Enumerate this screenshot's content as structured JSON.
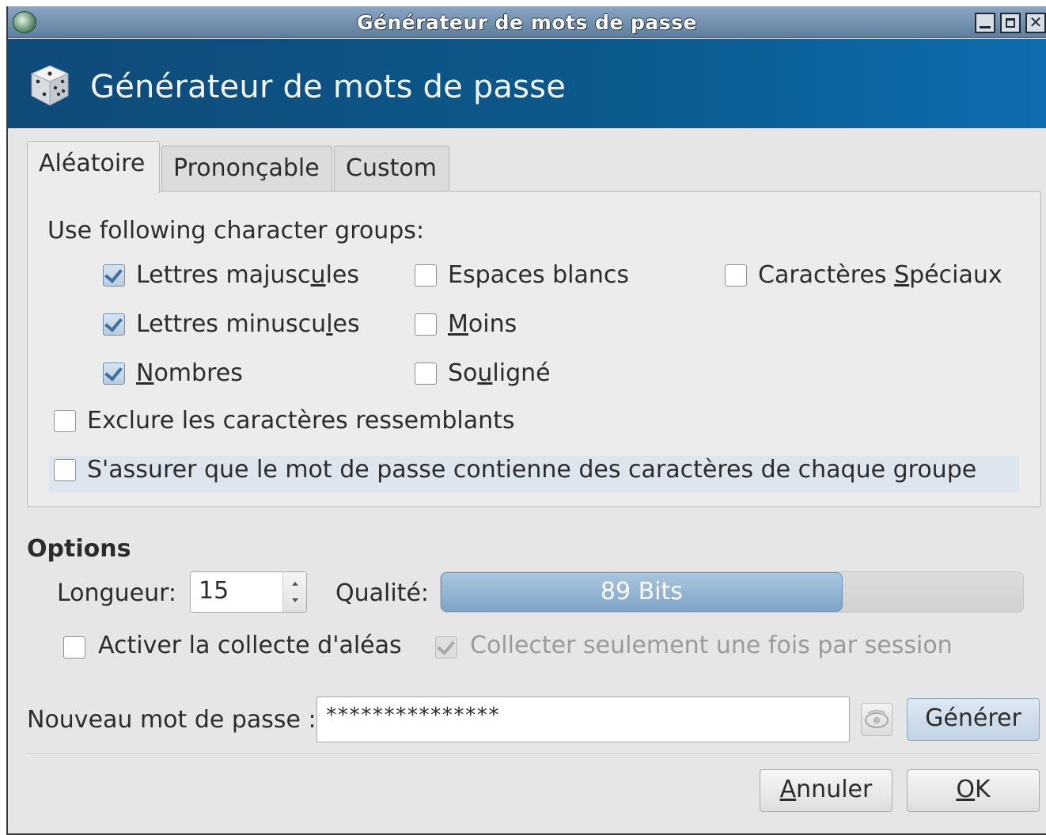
{
  "window": {
    "title": "Générateur de mots de passe",
    "header_title": "Générateur de mots de passe"
  },
  "tabs": [
    {
      "label": "Aléatoire",
      "active": true
    },
    {
      "label": "Prononçable",
      "active": false
    },
    {
      "label": "Custom",
      "active": false
    }
  ],
  "groups": {
    "heading": "Use following character groups:",
    "items": [
      {
        "label_pre": "Lettres majusc",
        "label_u": "u",
        "label_post": "les",
        "checked": true
      },
      {
        "label_pre": "Lettres minuscu",
        "label_u": "l",
        "label_post": "es",
        "checked": true
      },
      {
        "label_pre": "",
        "label_u": "N",
        "label_post": "ombres",
        "checked": true
      },
      {
        "label_pre": "Espaces blancs",
        "label_u": "",
        "label_post": "",
        "checked": false
      },
      {
        "label_pre": "",
        "label_u": "M",
        "label_post": "oins",
        "checked": false
      },
      {
        "label_pre": "So",
        "label_u": "u",
        "label_post": "ligné",
        "checked": false
      },
      {
        "label_pre": "Caractères ",
        "label_u": "S",
        "label_post": "péciaux",
        "checked": false
      }
    ],
    "exclude_similar": {
      "label": "Exclure les caractères ressemblants",
      "checked": false
    },
    "ensure_each_group": {
      "label": "S'assurer que le mot de passe contienne des caractères de chaque groupe",
      "checked": false
    }
  },
  "options": {
    "title": "Options",
    "length_label": "Longueur:",
    "length_value": "15",
    "quality_label": "Qualité:",
    "quality_text": "89 Bits",
    "quality_fraction": 0.69,
    "entropy_label": "Activer la collecte d'aléas",
    "entropy_checked": false,
    "once_label": "Collecter seulement une fois par session",
    "once_checked": true
  },
  "password": {
    "label": "Nouveau mot de passe :",
    "value": "***************",
    "generate": "Générer"
  },
  "buttons": {
    "cancel_u": "A",
    "cancel_rest": "nnuler",
    "ok_u": "O",
    "ok_rest": "K"
  }
}
